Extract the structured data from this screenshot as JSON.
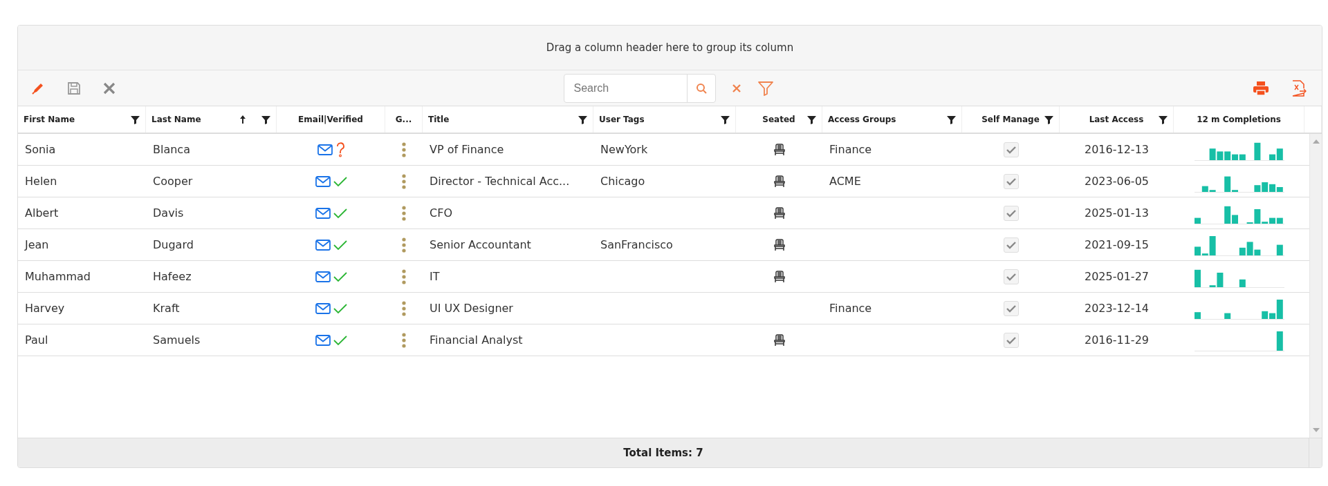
{
  "group_panel": {
    "hint": "Drag a column header here to group its column"
  },
  "toolbar": {
    "search": {
      "placeholder": "Search"
    }
  },
  "columns": [
    {
      "label": "First Name",
      "filter": true,
      "sorted_ascending": false
    },
    {
      "label": "Last Name",
      "filter": true,
      "sorted_ascending": true
    },
    {
      "label": "Email|Verified",
      "filter": false,
      "sorted_ascending": false
    },
    {
      "label": "G...",
      "filter": false,
      "sorted_ascending": false
    },
    {
      "label": "Title",
      "filter": true,
      "sorted_ascending": false
    },
    {
      "label": "User Tags",
      "filter": true,
      "sorted_ascending": false
    },
    {
      "label": "Seated",
      "filter": true,
      "sorted_ascending": false
    },
    {
      "label": "Access Groups",
      "filter": true,
      "sorted_ascending": false
    },
    {
      "label": "Self Manage",
      "filter": true,
      "sorted_ascending": false
    },
    {
      "label": "Last Access",
      "filter": true,
      "sorted_ascending": false
    },
    {
      "label": "12 m Completions",
      "filter": false,
      "sorted_ascending": false
    }
  ],
  "rows": [
    {
      "first_name": "Sonia",
      "last_name": "Blanca",
      "verified": false,
      "title": "VP of Finance",
      "user_tags": "NewYork",
      "seated": true,
      "access_groups": "Finance",
      "self_manage": true,
      "last_access": "2016-12-13"
    },
    {
      "first_name": "Helen",
      "last_name": "Cooper",
      "verified": true,
      "title": "Director - Technical Acc...",
      "user_tags": "Chicago",
      "seated": true,
      "access_groups": "ACME",
      "self_manage": true,
      "last_access": "2023-06-05"
    },
    {
      "first_name": "Albert",
      "last_name": "Davis",
      "verified": true,
      "title": "CFO",
      "seated": true,
      "self_manage": true,
      "last_access": "2025-01-13"
    },
    {
      "first_name": "Jean",
      "last_name": "Dugard",
      "verified": true,
      "title": "Senior Accountant",
      "user_tags": "SanFrancisco",
      "seated": true,
      "self_manage": true,
      "last_access": "2021-09-15"
    },
    {
      "first_name": "Muhammad",
      "last_name": "Hafeez",
      "verified": true,
      "title": "IT",
      "seated": true,
      "self_manage": true,
      "last_access": "2025-01-27"
    },
    {
      "first_name": "Harvey",
      "last_name": "Kraft",
      "verified": true,
      "title": "UI UX Designer",
      "seated": false,
      "access_groups": "Finance",
      "self_manage": true,
      "last_access": "2023-12-14"
    },
    {
      "first_name": "Paul",
      "last_name": "Samuels",
      "verified": true,
      "title": "Financial Analyst",
      "seated": true,
      "self_manage": true,
      "last_access": "2016-11-29"
    }
  ],
  "footer": {
    "total": "Total Items: 7"
  }
}
